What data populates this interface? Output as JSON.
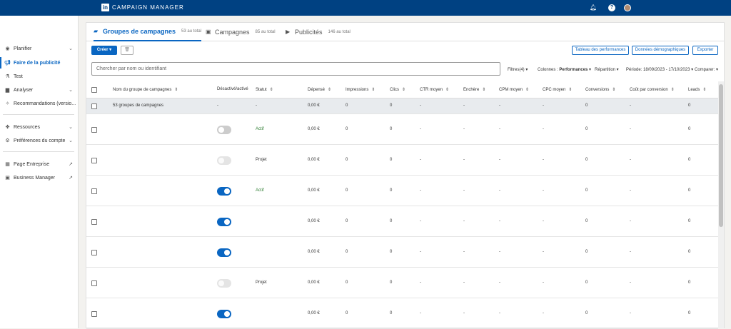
{
  "app": {
    "title": "CAMPAIGN MANAGER",
    "logo_text": "in"
  },
  "sidebar": {
    "items": [
      {
        "label": "Planifier",
        "icon": "compass-icon"
      },
      {
        "label": "Faire de la publicité",
        "icon": "megaphone-icon"
      },
      {
        "label": "Test",
        "icon": "flask-icon"
      },
      {
        "label": "Analyser",
        "icon": "chart-icon"
      },
      {
        "label": "Recommandations (versio...",
        "icon": "lightbulb-icon"
      },
      {
        "label": "Ressources",
        "icon": "shapes-icon"
      },
      {
        "label": "Préférences du compte",
        "icon": "gear-icon"
      },
      {
        "label": "Page Entreprise",
        "icon": "building-icon"
      },
      {
        "label": "Business Manager",
        "icon": "linkedin-icon"
      }
    ]
  },
  "tabs": [
    {
      "label": "Groupes de campagnes",
      "count": "53 au total"
    },
    {
      "label": "Campagnes",
      "count": "85 au total"
    },
    {
      "label": "Publicités",
      "count": "146 au total"
    }
  ],
  "toolbar": {
    "create": "Créer",
    "performance_chart": "Tableau des performances",
    "demographics": "Données démographiques",
    "export": "Exporter"
  },
  "search": {
    "placeholder": "Chercher par nom ou identifiant"
  },
  "filters": {
    "filters": "Filtres(4)",
    "columns_label": "Colonnes : ",
    "columns_value": "Performances",
    "breakdown": "Répartition",
    "period": "Période: 18/09/2023 - 17/10/2023",
    "compare": "Comparer:"
  },
  "table": {
    "headers": [
      "Nom du groupe de campagnes",
      "Désactivé/activé",
      "Statut",
      "Dépensé",
      "Impressions",
      "Clics",
      "CTR moyen",
      "Enchère",
      "CPM moyen",
      "CPC moyen",
      "Conversions",
      "Coût par conversion",
      "Leads"
    ],
    "summary": {
      "name": "53 groupes de campagnes",
      "toggle": "-",
      "status": "-",
      "spent": "0,00 €",
      "impressions": "0",
      "clicks": "0",
      "ctr": "-",
      "bid": "-",
      "cpm": "-",
      "cpc": "-",
      "conversions": "0",
      "cost_per_conv": "-",
      "leads": "0"
    },
    "rows": [
      {
        "toggle": "off",
        "status": "Actif",
        "spent": "0,00 €",
        "impressions": "0",
        "clicks": "0",
        "ctr": "-",
        "bid": "-",
        "cpm": "-",
        "cpc": "-",
        "conversions": "0",
        "cost_per_conv": "-",
        "leads": "0"
      },
      {
        "toggle": "off-light",
        "status": "Projet",
        "spent": "0,00 €",
        "impressions": "0",
        "clicks": "0",
        "ctr": "-",
        "bid": "-",
        "cpm": "-",
        "cpc": "-",
        "conversions": "0",
        "cost_per_conv": "-",
        "leads": "0"
      },
      {
        "toggle": "on",
        "status": "Actif",
        "spent": "0,00 €",
        "impressions": "0",
        "clicks": "0",
        "ctr": "-",
        "bid": "-",
        "cpm": "-",
        "cpc": "-",
        "conversions": "0",
        "cost_per_conv": "-",
        "leads": "0"
      },
      {
        "toggle": "on",
        "status": "",
        "spent": "0,00 €",
        "impressions": "0",
        "clicks": "0",
        "ctr": "-",
        "bid": "-",
        "cpm": "-",
        "cpc": "-",
        "conversions": "0",
        "cost_per_conv": "-",
        "leads": "0"
      },
      {
        "toggle": "on",
        "status": "",
        "spent": "0,00 €",
        "impressions": "0",
        "clicks": "0",
        "ctr": "-",
        "bid": "-",
        "cpm": "-",
        "cpc": "-",
        "conversions": "0",
        "cost_per_conv": "-",
        "leads": "0"
      },
      {
        "toggle": "off-light",
        "status": "Projet",
        "spent": "0,00 €",
        "impressions": "0",
        "clicks": "0",
        "ctr": "-",
        "bid": "-",
        "cpm": "-",
        "cpc": "-",
        "conversions": "0",
        "cost_per_conv": "-",
        "leads": "0"
      },
      {
        "toggle": "on",
        "status": "",
        "spent": "0,00 €",
        "impressions": "0",
        "clicks": "0",
        "ctr": "-",
        "bid": "-",
        "cpm": "-",
        "cpc": "-",
        "conversions": "0",
        "cost_per_conv": "-",
        "leads": "0"
      }
    ]
  },
  "colors": {
    "brand": "#004182",
    "accent": "#0a66c2",
    "active_status": "#2e7d32"
  }
}
